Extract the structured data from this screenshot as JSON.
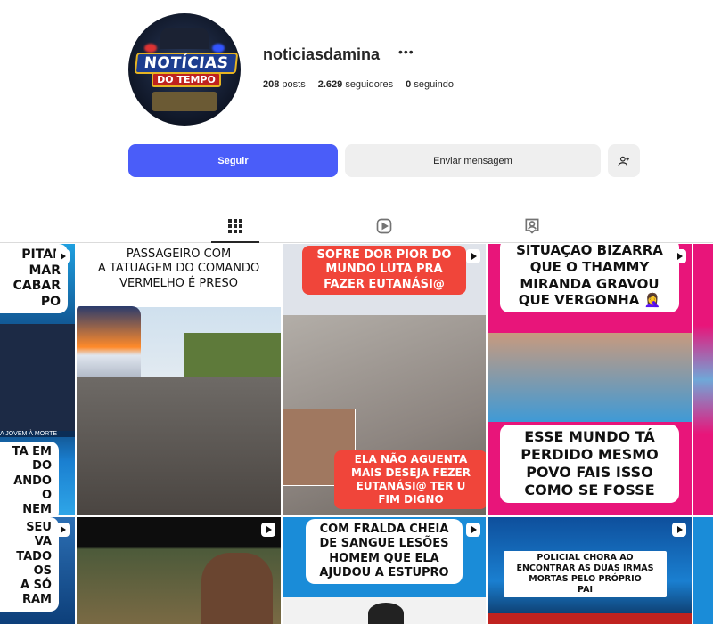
{
  "profile": {
    "username": "noticiasdamina",
    "more_icon": "•••",
    "avatar_logo_line1": "NOTÍCIAS",
    "avatar_logo_line2": "DO TEMPO",
    "posts_count": "208",
    "posts_label": "posts",
    "followers_count": "2.629",
    "followers_label": "seguidores",
    "following_count": "0",
    "following_label": "seguindo"
  },
  "actions": {
    "follow": "Seguir",
    "message": "Enviar mensagem",
    "add_icon": "person-add-icon"
  },
  "tabs": [
    {
      "name": "posts",
      "icon": "grid-icon",
      "active": true
    },
    {
      "name": "reels",
      "icon": "reels-icon",
      "active": false
    },
    {
      "name": "tagged",
      "icon": "tagged-icon",
      "active": false
    }
  ],
  "posts": {
    "p1_text_a": "PITAL\nMAR\nCABAR\nPO",
    "p1_text_b": "A JOVEM À MORTE",
    "p1_text_c": "TA EM\nDO\nANDO\nO\nNEM",
    "p2_caption": "PASSAGEIRO COM\nA TATUAGEM DO COMANDO\nVERMELHO É PRESO",
    "p3_caption_top": "SOFRE DOR PIOR DO\nMUNDO LUTA PRA\nFAZER EUTANÁSI@",
    "p3_caption_bottom": "ELA NÃO  AGUENTA\nMAIS  DESEJA FEZER\nEUTANÁSI@ TER U\nFIM DIGNO",
    "p4_caption_top": "SITUAÇÃO BIZARRA\nQUE O THAMMY\nMIRANDA GRAVOU\nQUE VERGONHA 🤦‍♀️",
    "p4_caption_bottom": "ESSE MUNDO TÁ\nPERDIDO MESMO\nPOVO FAIS ISSO\nCOMO SE FOSSE",
    "p6_text": "SEU\nVA\nTADO\nOS\nA SÓ\nRAM",
    "p8_caption": "COM FRALDA CHEIA\nDE SANGUE LESÕES\nHOMEM QUE ELA\nAJUDOU A ESTUPRO",
    "p9_caption": "POLICIAL CHORA AO\nENCONTRAR AS DUAS IRMÃS\nMORTAS PELO PRÓPRIO\nPAI"
  }
}
